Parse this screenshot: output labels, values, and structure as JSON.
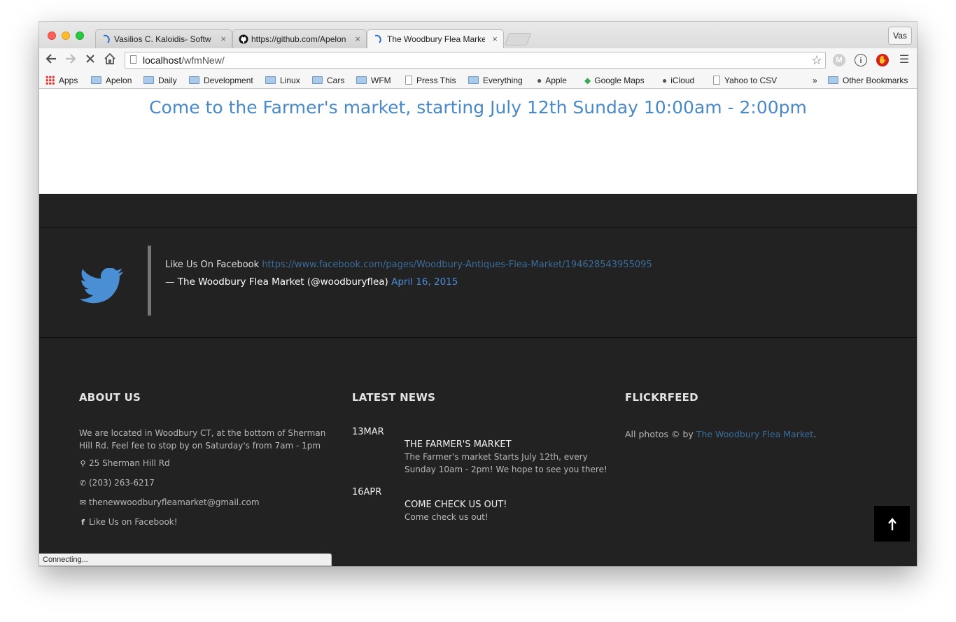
{
  "browser": {
    "tabs": [
      {
        "title": "Vasilios C. Kaloidis- Softw",
        "active": false
      },
      {
        "title": "https://github.com/Apelon",
        "active": false
      },
      {
        "title": "The Woodbury Flea Market",
        "active": true
      }
    ],
    "close_glyph": "×",
    "user_label": "Vas",
    "url_host": "localhost",
    "url_path": "/wfmNew/",
    "bookmarks": [
      "Apps",
      "Apelon",
      "Daily",
      "Development",
      "Linux",
      "Cars",
      "WFM",
      "Press This",
      "Everything",
      "Apple",
      "Google Maps",
      "iCloud",
      "Yahoo to CSV"
    ],
    "overflow_label": "»",
    "other_bookmarks": "Other Bookmarks",
    "status_text": "Connecting..."
  },
  "hero": {
    "title": "Come to the Farmer's market, starting July 12th Sunday 10:00am - 2:00pm"
  },
  "tweet": {
    "prefix": "Like Us On Facebook",
    "link": "https://www.facebook.com/pages/Woodbury-Antiques-Flea-Market/194628543955095",
    "author": "— The Woodbury Flea Market (@woodburyflea)",
    "date": "April 16, 2015"
  },
  "about": {
    "heading": "ABOUT US",
    "text": "We are located in Woodbury CT, at the bottom of Sherman Hill Rd. Feel fee to stop by on Saturday's from 7am - 1pm",
    "address": "25 Sherman Hill Rd",
    "phone": "(203) 263-6217",
    "email": "thenewwoodburyfleamarket@gmail.com",
    "facebook": "Like Us on Facebook!"
  },
  "news": {
    "heading": "LATEST NEWS",
    "items": [
      {
        "date": "13MAR",
        "title": "THE FARMER'S MARKET",
        "body": "The Farmer's market Starts July 12th, every Sunday 10am - 2pm! We hope to see you there!"
      },
      {
        "date": "16APR",
        "title": "COME CHECK US OUT!",
        "body": "Come check us out!"
      }
    ]
  },
  "flickr": {
    "heading": "FLICKRFEED",
    "prefix": "All photos © by",
    "link": "The Woodbury Flea Market",
    "suffix": "."
  },
  "colors": {
    "accent": "#4a89c8",
    "footer_bg": "#222223",
    "link_dark": "#3b6d99"
  },
  "icons": [
    "twitter-bird-icon",
    "map-marker-icon",
    "phone-icon",
    "envelope-icon",
    "facebook-icon",
    "arrow-up-icon"
  ]
}
